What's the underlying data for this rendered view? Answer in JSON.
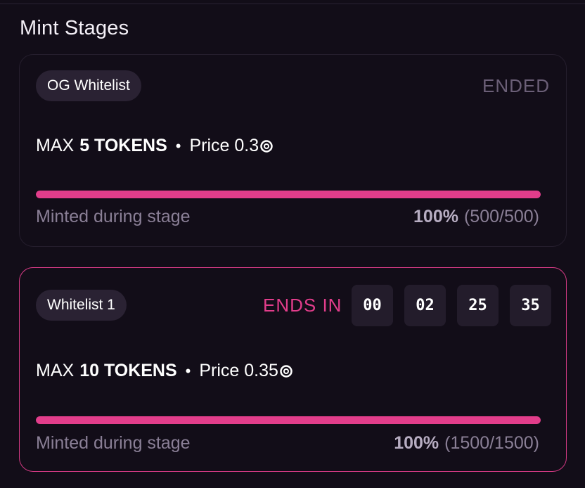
{
  "section": {
    "title": "Mint Stages"
  },
  "colors": {
    "accent": "#e23d8b",
    "background": "#120d18",
    "badge_bg": "#2a2233",
    "muted_text": "#8a7f96"
  },
  "stages": [
    {
      "name": "OG Whitelist",
      "status": "ENDED",
      "max_prefix": "MAX",
      "max_value": "5 TOKENS",
      "dot": "•",
      "price_label": "Price 0.3",
      "currency_icon": "coin-icon",
      "progress": 1.0,
      "minted_label": "Minted during stage",
      "minted_percent": "100%",
      "minted_count": "(500/500)"
    },
    {
      "name": "Whitelist 1",
      "status": "ENDS IN",
      "countdown": [
        "00",
        "02",
        "25",
        "35"
      ],
      "max_prefix": "MAX",
      "max_value": "10 TOKENS",
      "dot": "•",
      "price_label": "Price 0.35",
      "currency_icon": "coin-icon",
      "progress": 1.0,
      "minted_label": "Minted during stage",
      "minted_percent": "100%",
      "minted_count": "(1500/1500)"
    }
  ]
}
